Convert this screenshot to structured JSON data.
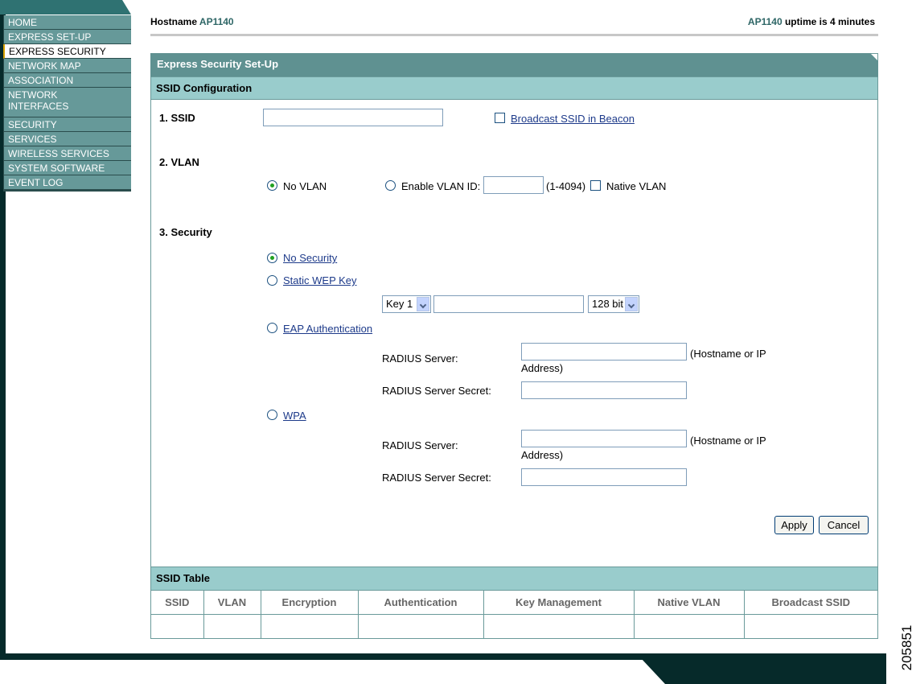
{
  "nav": {
    "items": [
      {
        "label": "HOME"
      },
      {
        "label": "EXPRESS SET-UP"
      },
      {
        "label": "EXPRESS SECURITY"
      },
      {
        "label": "NETWORK MAP"
      },
      {
        "label": "ASSOCIATION"
      },
      {
        "label": "NETWORK\nINTERFACES"
      },
      {
        "label": "SECURITY"
      },
      {
        "label": "SERVICES"
      },
      {
        "label": "WIRELESS SERVICES"
      },
      {
        "label": "SYSTEM SOFTWARE"
      },
      {
        "label": "EVENT LOG"
      }
    ],
    "active_index": 2
  },
  "header": {
    "hostname_label": "Hostname",
    "hostname_value": "AP1140",
    "uptime_host": "AP1140",
    "uptime_text": "uptime is 4 minutes"
  },
  "panel": {
    "title": "Express Security Set-Up",
    "ssid_config_title": "SSID Configuration",
    "ssid": {
      "label": "1. SSID",
      "value": "",
      "broadcast_label": "Broadcast SSID in Beacon",
      "broadcast_checked": false
    },
    "vlan": {
      "label": "2. VLAN",
      "no_vlan_label": "No VLAN",
      "enable_vlan_label": "Enable VLAN ID:",
      "vlan_id_value": "",
      "range_text": "(1-4094)",
      "native_vlan_label": "Native VLAN",
      "selected": "no_vlan"
    },
    "security": {
      "label": "3. Security",
      "selected": "no_security",
      "no_security_label": "No Security",
      "static_wep_label": "Static WEP Key",
      "key_select": "Key 1",
      "key_value": "",
      "bit_select": "128 bit",
      "eap_label": "EAP Authentication",
      "eap_radius_server_label": "RADIUS Server:",
      "eap_radius_server_value": "",
      "eap_hint_line1": "(Hostname or IP",
      "eap_hint_line2": "Address)",
      "eap_radius_secret_label": "RADIUS Server Secret:",
      "eap_radius_secret_value": "",
      "wpa_label": "WPA",
      "wpa_radius_server_label": "RADIUS Server:",
      "wpa_radius_server_value": "",
      "wpa_hint_line1": "(Hostname or IP",
      "wpa_hint_line2": "Address)",
      "wpa_radius_secret_label": "RADIUS Server Secret:",
      "wpa_radius_secret_value": ""
    },
    "buttons": {
      "apply": "Apply",
      "cancel": "Cancel"
    }
  },
  "ssid_table": {
    "title": "SSID Table",
    "columns": [
      "SSID",
      "VLAN",
      "Encryption",
      "Authentication",
      "Key Management",
      "Native VLAN",
      "Broadcast SSID"
    ],
    "rows": [
      [
        "",
        "",
        "",
        "",
        "",
        "",
        ""
      ]
    ]
  },
  "figure_id": "205851",
  "colors": {
    "nav_bg": "#669999",
    "title_bar": "#5f9191",
    "section_bar": "#99cccc",
    "dark_frame": "#062a2a",
    "link": "#1d3a8a"
  }
}
